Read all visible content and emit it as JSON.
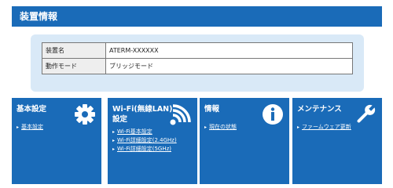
{
  "header": {
    "title": "装置情報"
  },
  "device_info": {
    "rows": [
      {
        "label": "装置名",
        "value": "ATERM-XXXXXX"
      },
      {
        "label": "動作モード",
        "value": "ブリッジモード"
      }
    ]
  },
  "cards": [
    {
      "title": "基本設定",
      "icon": "gear-icon",
      "links": [
        "基本設定"
      ]
    },
    {
      "title": "Wi-Fi(無線LAN)設定",
      "icon": "wifi-icon",
      "links": [
        "Wi-Fi基本設定",
        "Wi-Fi詳細設定(2.4GHz)",
        "Wi-Fi詳細設定(5GHz)"
      ]
    },
    {
      "title": "情報",
      "icon": "info-icon",
      "links": [
        "現在の状態"
      ]
    },
    {
      "title": "メンテナンス",
      "icon": "wrench-icon",
      "links": [
        "ファームウェア更新"
      ]
    }
  ],
  "colors": {
    "primary": "#1a6bb8",
    "panel": "#d9e9f7"
  }
}
